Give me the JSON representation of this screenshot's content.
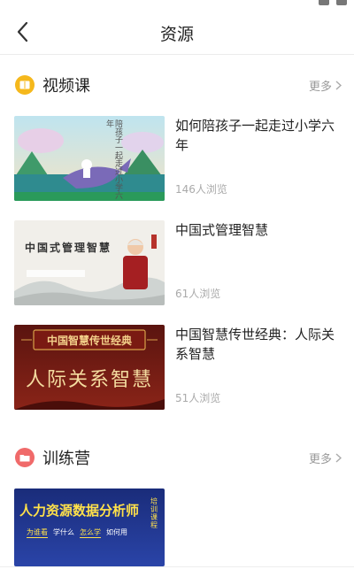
{
  "header": {
    "title": "资源"
  },
  "video_section": {
    "title": "视频课",
    "more_label": "更多",
    "icon_color": "#f5b81c",
    "items": [
      {
        "title": "如何陪孩子一起走过小学六年",
        "views": "146人浏览",
        "thumb_text": "陪孩子一起走过小学六年"
      },
      {
        "title": "中国式管理智慧",
        "views": "61人浏览",
        "thumb_text": "中国式管理智慧"
      },
      {
        "title": "中国智慧传世经典：人际关系智慧",
        "views": "51人浏览",
        "thumb_banner": "中国智慧传世经典",
        "thumb_text": "人际关系智慧"
      }
    ]
  },
  "camp_section": {
    "title": "训练营",
    "more_label": "更多",
    "icon_color": "#f06a6a",
    "items": [
      {
        "thumb_text": "人力资源数据分析师",
        "thumb_badge": "培训课程",
        "thumb_tags": [
          "为谁看",
          "学什么",
          "怎么学",
          "如何用"
        ]
      }
    ]
  }
}
